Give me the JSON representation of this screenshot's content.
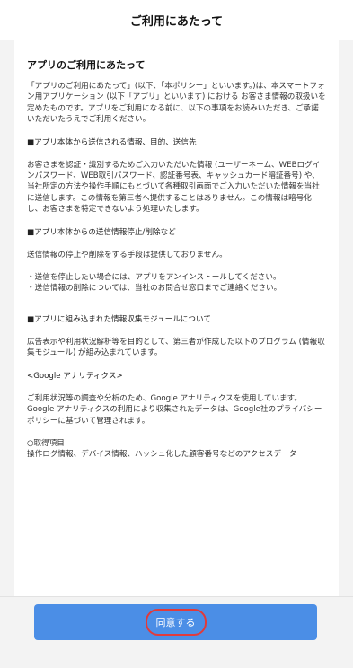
{
  "header": {
    "title": "ご利用にあたって"
  },
  "doc": {
    "title": "アプリのご利用にあたって",
    "intro": "「アプリのご利用にあたって」(以下、「本ポリシー」といいます。)は、本スマートフォン用アプリケーション (以下「アプリ」といいます) における お客さま情報の取扱いを定めたものです。アプリをご利用になる前に、以下の事項をお読みいただき、ご承諾いただいたうえでご利用ください。",
    "section1_head": "■アプリ本体から送信される情報、目的、送信先",
    "section1_body": "お客さまを認証・識別するためご入力いただいた情報 (ユーザーネーム、WEBログインパスワード、WEB取引パスワード、認証番号表、キャッシュカード暗証番号) や、当社所定の方法や操作手順にもとづいて各種取引画面でご入力いただいた情報を当社に送信します。この情報を第三者へ提供することはありません。この情報は暗号化し、お客さまを特定できないよう処理いたします。",
    "section2_head": "■アプリ本体からの送信情報停止/削除など",
    "section2_body": "送信情報の停止や削除をする手段は提供しておりません。",
    "section2_bullet1": "・送信を停止したい場合には、アプリをアンインストールしてください。",
    "section2_bullet2": "・送信情報の削除については、当社のお問合せ窓口までご連絡ください。",
    "section3_head": "■アプリに組み込まれた情報収集モジュールについて",
    "section3_body": "広告表示や利用状況解析等を目的として、第三者が作成した以下のプログラム (情報収集モジュール) が組み込まれています。",
    "ga_head": "<Google アナリティクス>",
    "ga_body": "ご利用状況等の調査や分析のため、Google アナリティクスを使用しています。Google アナリティクスの利用により収集されたデータは、Google社のプライバシーポリシーに基づいて管理されます。",
    "items_head": "○取得項目",
    "items_body": "操作ログ情報、デバイス情報、ハッシュ化した顧客番号などのアクセスデータ"
  },
  "footer": {
    "agree_label": "同意する"
  }
}
